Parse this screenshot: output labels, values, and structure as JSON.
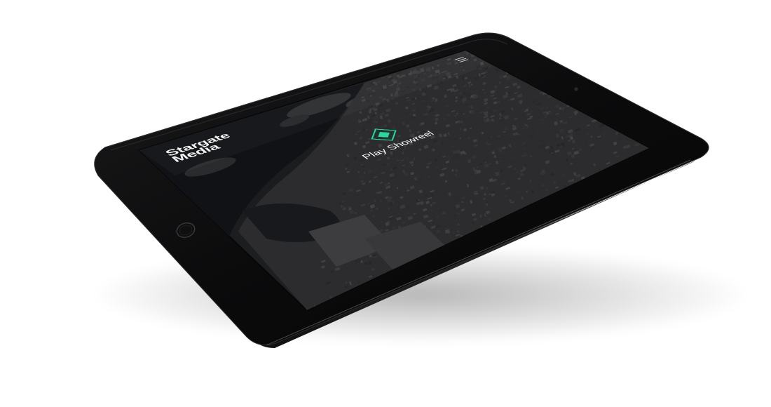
{
  "screen_ui": {
    "logo": {
      "line1": "Stargate",
      "line2": "Media"
    },
    "play_button": {
      "label": "Play Showreel"
    }
  },
  "colors": {
    "accent": "#2dd3a1",
    "device_body": "#0b0b0c",
    "screen_bg": "#141517",
    "background": "#ffffff"
  },
  "icons": {
    "play": "play-diamond-icon",
    "menu": "hamburger-menu-icon",
    "home": "home-button-icon",
    "camera": "camera-icon"
  }
}
